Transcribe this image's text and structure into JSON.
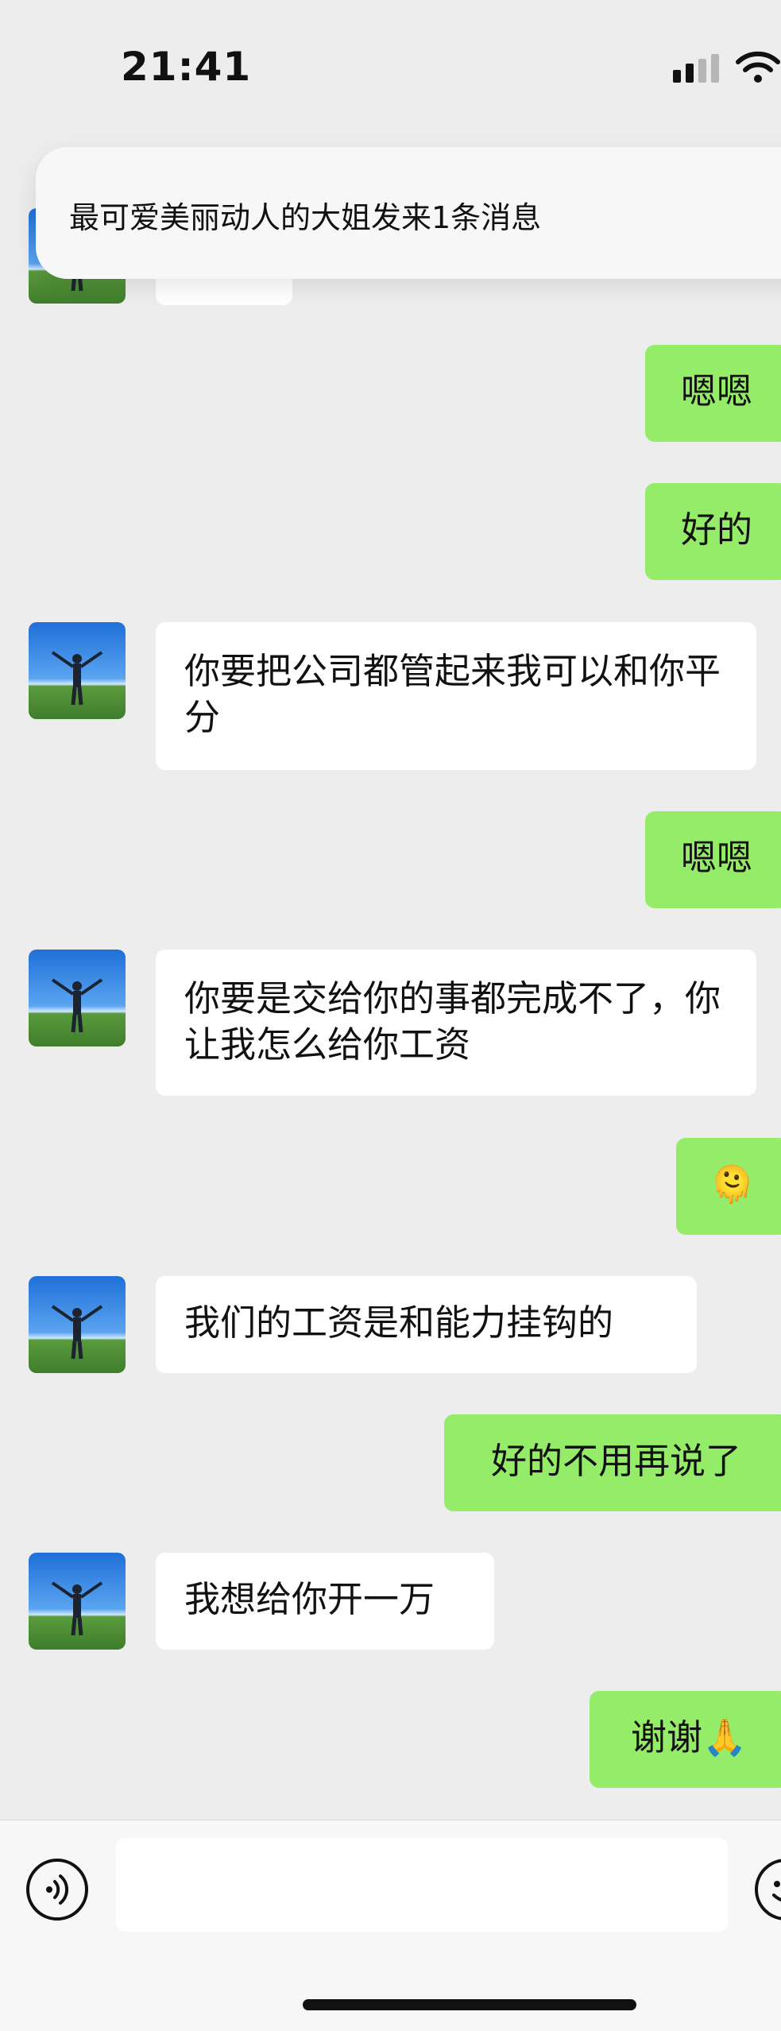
{
  "status_bar": {
    "time": "21:41"
  },
  "notification": {
    "text": "最可爱美丽动人的大姐发来1条消息"
  },
  "messages": [
    {
      "side": "out",
      "text": "嗯嗯"
    },
    {
      "side": "out",
      "text": "好的"
    },
    {
      "side": "in",
      "text": "你要把公司都管起来我可以和你平分"
    },
    {
      "side": "out",
      "text": "嗯嗯"
    },
    {
      "side": "in",
      "text": "你要是交给你的事都完成不了，你让我怎么给你工资"
    },
    {
      "side": "out",
      "text": "🫠"
    },
    {
      "side": "in",
      "text": "我们的工资是和能力挂钩的"
    },
    {
      "side": "out",
      "text": "好的不用再说了"
    },
    {
      "side": "in",
      "text": "我想给你开一万"
    },
    {
      "side": "out",
      "text": "谢谢🙏"
    }
  ],
  "icons": {
    "signal": "cellular-signal-icon",
    "wifi": "wifi-icon",
    "voice": "voice-input-icon",
    "emoji": "emoji-icon"
  },
  "colors": {
    "chat_background": "#ededed",
    "outgoing_bubble": "#95ec69",
    "incoming_bubble": "#ffffff"
  }
}
